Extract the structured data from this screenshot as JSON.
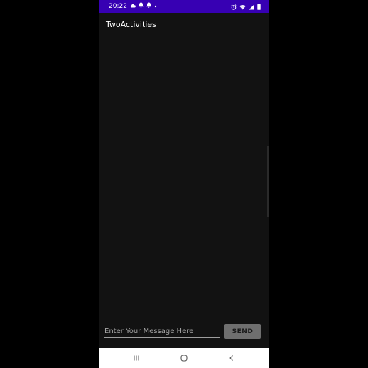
{
  "status_bar": {
    "time": "20:22",
    "left_icons": [
      "cloud-icon",
      "notification-icon",
      "notification-icon",
      "dot-icon"
    ],
    "right_icons": [
      "alarm-icon",
      "wifi-icon",
      "signal-icon",
      "battery-icon"
    ],
    "color": "#3700b3"
  },
  "app_bar": {
    "title": "TwoActivities"
  },
  "message": {
    "placeholder": "Enter Your Message Here",
    "value": ""
  },
  "send_button": {
    "label": "SEND"
  },
  "nav_bar": {
    "buttons": [
      "recents-icon",
      "home-icon",
      "back-icon"
    ]
  }
}
